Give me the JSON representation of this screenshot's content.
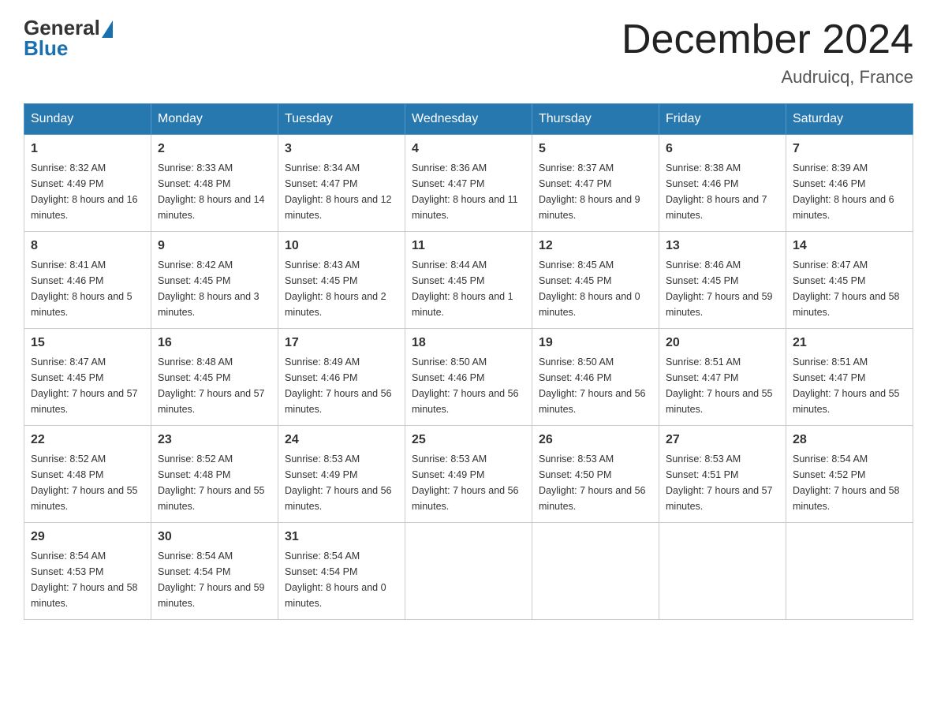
{
  "header": {
    "logo": {
      "general": "General",
      "blue": "Blue"
    },
    "title": "December 2024",
    "location": "Audruicq, France"
  },
  "days_of_week": [
    "Sunday",
    "Monday",
    "Tuesday",
    "Wednesday",
    "Thursday",
    "Friday",
    "Saturday"
  ],
  "weeks": [
    [
      {
        "day": "1",
        "sunrise": "8:32 AM",
        "sunset": "4:49 PM",
        "daylight": "8 hours and 16 minutes."
      },
      {
        "day": "2",
        "sunrise": "8:33 AM",
        "sunset": "4:48 PM",
        "daylight": "8 hours and 14 minutes."
      },
      {
        "day": "3",
        "sunrise": "8:34 AM",
        "sunset": "4:47 PM",
        "daylight": "8 hours and 12 minutes."
      },
      {
        "day": "4",
        "sunrise": "8:36 AM",
        "sunset": "4:47 PM",
        "daylight": "8 hours and 11 minutes."
      },
      {
        "day": "5",
        "sunrise": "8:37 AM",
        "sunset": "4:47 PM",
        "daylight": "8 hours and 9 minutes."
      },
      {
        "day": "6",
        "sunrise": "8:38 AM",
        "sunset": "4:46 PM",
        "daylight": "8 hours and 7 minutes."
      },
      {
        "day": "7",
        "sunrise": "8:39 AM",
        "sunset": "4:46 PM",
        "daylight": "8 hours and 6 minutes."
      }
    ],
    [
      {
        "day": "8",
        "sunrise": "8:41 AM",
        "sunset": "4:46 PM",
        "daylight": "8 hours and 5 minutes."
      },
      {
        "day": "9",
        "sunrise": "8:42 AM",
        "sunset": "4:45 PM",
        "daylight": "8 hours and 3 minutes."
      },
      {
        "day": "10",
        "sunrise": "8:43 AM",
        "sunset": "4:45 PM",
        "daylight": "8 hours and 2 minutes."
      },
      {
        "day": "11",
        "sunrise": "8:44 AM",
        "sunset": "4:45 PM",
        "daylight": "8 hours and 1 minute."
      },
      {
        "day": "12",
        "sunrise": "8:45 AM",
        "sunset": "4:45 PM",
        "daylight": "8 hours and 0 minutes."
      },
      {
        "day": "13",
        "sunrise": "8:46 AM",
        "sunset": "4:45 PM",
        "daylight": "7 hours and 59 minutes."
      },
      {
        "day": "14",
        "sunrise": "8:47 AM",
        "sunset": "4:45 PM",
        "daylight": "7 hours and 58 minutes."
      }
    ],
    [
      {
        "day": "15",
        "sunrise": "8:47 AM",
        "sunset": "4:45 PM",
        "daylight": "7 hours and 57 minutes."
      },
      {
        "day": "16",
        "sunrise": "8:48 AM",
        "sunset": "4:45 PM",
        "daylight": "7 hours and 57 minutes."
      },
      {
        "day": "17",
        "sunrise": "8:49 AM",
        "sunset": "4:46 PM",
        "daylight": "7 hours and 56 minutes."
      },
      {
        "day": "18",
        "sunrise": "8:50 AM",
        "sunset": "4:46 PM",
        "daylight": "7 hours and 56 minutes."
      },
      {
        "day": "19",
        "sunrise": "8:50 AM",
        "sunset": "4:46 PM",
        "daylight": "7 hours and 56 minutes."
      },
      {
        "day": "20",
        "sunrise": "8:51 AM",
        "sunset": "4:47 PM",
        "daylight": "7 hours and 55 minutes."
      },
      {
        "day": "21",
        "sunrise": "8:51 AM",
        "sunset": "4:47 PM",
        "daylight": "7 hours and 55 minutes."
      }
    ],
    [
      {
        "day": "22",
        "sunrise": "8:52 AM",
        "sunset": "4:48 PM",
        "daylight": "7 hours and 55 minutes."
      },
      {
        "day": "23",
        "sunrise": "8:52 AM",
        "sunset": "4:48 PM",
        "daylight": "7 hours and 55 minutes."
      },
      {
        "day": "24",
        "sunrise": "8:53 AM",
        "sunset": "4:49 PM",
        "daylight": "7 hours and 56 minutes."
      },
      {
        "day": "25",
        "sunrise": "8:53 AM",
        "sunset": "4:49 PM",
        "daylight": "7 hours and 56 minutes."
      },
      {
        "day": "26",
        "sunrise": "8:53 AM",
        "sunset": "4:50 PM",
        "daylight": "7 hours and 56 minutes."
      },
      {
        "day": "27",
        "sunrise": "8:53 AM",
        "sunset": "4:51 PM",
        "daylight": "7 hours and 57 minutes."
      },
      {
        "day": "28",
        "sunrise": "8:54 AM",
        "sunset": "4:52 PM",
        "daylight": "7 hours and 58 minutes."
      }
    ],
    [
      {
        "day": "29",
        "sunrise": "8:54 AM",
        "sunset": "4:53 PM",
        "daylight": "7 hours and 58 minutes."
      },
      {
        "day": "30",
        "sunrise": "8:54 AM",
        "sunset": "4:54 PM",
        "daylight": "7 hours and 59 minutes."
      },
      {
        "day": "31",
        "sunrise": "8:54 AM",
        "sunset": "4:54 PM",
        "daylight": "8 hours and 0 minutes."
      },
      null,
      null,
      null,
      null
    ]
  ],
  "labels": {
    "sunrise": "Sunrise:",
    "sunset": "Sunset:",
    "daylight": "Daylight:"
  }
}
